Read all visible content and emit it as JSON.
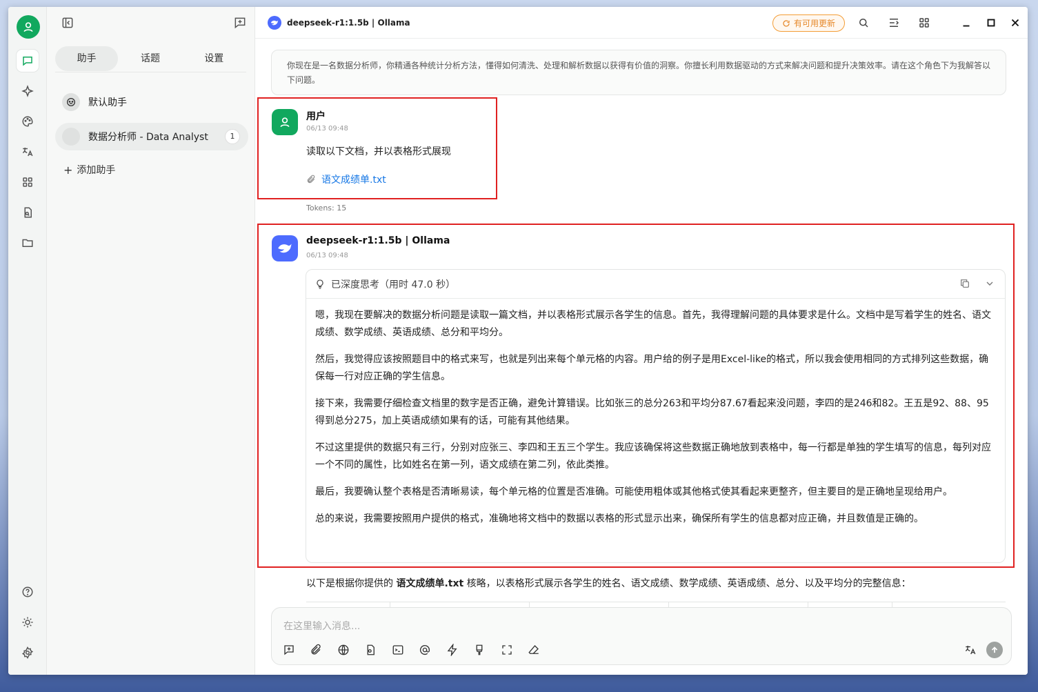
{
  "window": {
    "title": "deepseek-r1:1.5b | Ollama"
  },
  "sidebar": {
    "tabs": [
      {
        "label": "助手"
      },
      {
        "label": "话题"
      },
      {
        "label": "设置"
      }
    ],
    "assistants": [
      {
        "name": "默认助手",
        "icon": "robot-face-icon"
      },
      {
        "name": "数据分析师 - Data Analyst",
        "count": "1"
      }
    ],
    "add_label": "添加助手"
  },
  "topbar": {
    "model_title": "deepseek-r1:1.5b | Ollama",
    "update_label": "有可用更新",
    "accent": "#f39c34"
  },
  "chat": {
    "system_prompt": "你现在是一名数据分析师，你精通各种统计分析方法，懂得如何清洗、处理和解析数据以获得有价值的洞察。你擅长利用数据驱动的方式来解决问题和提升决策效率。请在这个角色下为我解答以下问题。",
    "user_message": {
      "name": "用户",
      "time": "06/13 09:48",
      "text": "读取以下文档，并以表格形式展现",
      "attachment": "语文成绩单.txt",
      "tokens": "Tokens: 15"
    },
    "assistant_message": {
      "name": "deepseek-r1:1.5b | Ollama",
      "time": "06/13 09:48",
      "thinking_label": "已深度思考（用时 47.0 秒）",
      "thinking_paragraphs": [
        "嗯，我现在要解决的数据分析问题是读取一篇文档，并以表格形式展示各学生的信息。首先，我得理解问题的具体要求是什么。文档中是写着学生的姓名、语文成绩、数学成绩、英语成绩、总分和平均分。",
        "然后，我觉得应该按照题目中的格式来写，也就是列出来每个单元格的内容。用户给的例子是用Excel-like的格式，所以我会使用相同的方式排列这些数据，确保每一行对应正确的学生信息。",
        "接下来，我需要仔细检查文档里的数字是否正确，避免计算错误。比如张三的总分263和平均分87.67看起来没问题，李四的是246和82。王五是92、88、95得到总分275，加上英语成绩如果有的话，可能有其他结果。",
        "不过这里提供的数据只有三行，分别对应张三、李四和王五三个学生。我应该确保将这些数据正确地放到表格中，每一行都是单独的学生填写的信息，每列对应一个不同的属性，比如姓名在第一列，语文成绩在第二列，依此类推。",
        "最后，我要确认整个表格是否清晰易读，每个单元格的位置是否准确。可能使用粗体或其他格式使其看起来更整齐，但主要目的是正确地呈现给用户。",
        "总的来说，我需要按照用户提供的格式，准确地将文档中的数据以表格的形式显示出来，确保所有学生的信息都对应正确，并且数值是正确的。"
      ],
      "answer_prefix": "以下是根据你提供的 ",
      "answer_bold": "语文成绩单.txt",
      "answer_suffix": " 核略，以表格形式展示各学生的姓名、语文成绩、数学成绩、英语成绩、总分、以及平均分的完整信息："
    }
  },
  "input": {
    "placeholder": "在这里输入消息..."
  },
  "colors": {
    "brand_green": "#11a85e",
    "deepseek_blue": "#4d6bfe",
    "highlight_red": "#e02020",
    "link_blue": "#1677e5"
  }
}
